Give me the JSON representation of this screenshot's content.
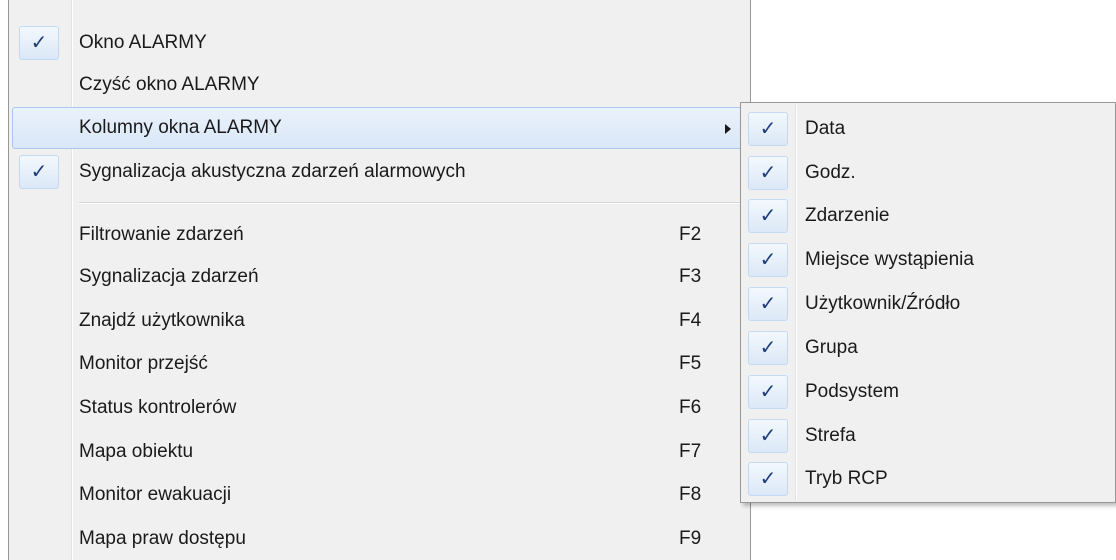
{
  "main_menu": {
    "items": [
      {
        "label": "Okno ALARMY",
        "checked": true,
        "shortcut": ""
      },
      {
        "label": "Czyść okno ALARMY",
        "checked": false,
        "shortcut": ""
      },
      {
        "label": "Kolumny okna ALARMY",
        "checked": false,
        "shortcut": "",
        "has_submenu": true,
        "highlighted": true
      },
      {
        "label": "Sygnalizacja akustyczna zdarzeń alarmowych",
        "checked": true,
        "shortcut": ""
      },
      {
        "label": "Filtrowanie zdarzeń",
        "checked": false,
        "shortcut": "F2"
      },
      {
        "label": "Sygnalizacja zdarzeń",
        "checked": false,
        "shortcut": "F3"
      },
      {
        "label": "Znajdź użytkownika",
        "checked": false,
        "shortcut": "F4"
      },
      {
        "label": "Monitor przejść",
        "checked": false,
        "shortcut": "F5"
      },
      {
        "label": "Status kontrolerów",
        "checked": false,
        "shortcut": "F6"
      },
      {
        "label": "Mapa obiektu",
        "checked": false,
        "shortcut": "F7"
      },
      {
        "label": "Monitor ewakuacji",
        "checked": false,
        "shortcut": "F8"
      },
      {
        "label": "Mapa praw dostępu",
        "checked": false,
        "shortcut": "F9"
      }
    ],
    "check_glyph": "✓"
  },
  "submenu": {
    "items": [
      {
        "label": "Data",
        "checked": true
      },
      {
        "label": "Godz.",
        "checked": true
      },
      {
        "label": "Zdarzenie",
        "checked": true
      },
      {
        "label": "Miejsce wystąpienia",
        "checked": true
      },
      {
        "label": "Użytkownik/Źródło",
        "checked": true
      },
      {
        "label": "Grupa",
        "checked": true
      },
      {
        "label": "Podsystem",
        "checked": true
      },
      {
        "label": "Strefa",
        "checked": true
      },
      {
        "label": "Tryb RCP",
        "checked": true
      }
    ],
    "check_glyph": "✓"
  },
  "colors": {
    "menu_background": "#f0f0f0",
    "highlight_border": "#a8c8ee",
    "check_color": "#1f3d7a"
  }
}
